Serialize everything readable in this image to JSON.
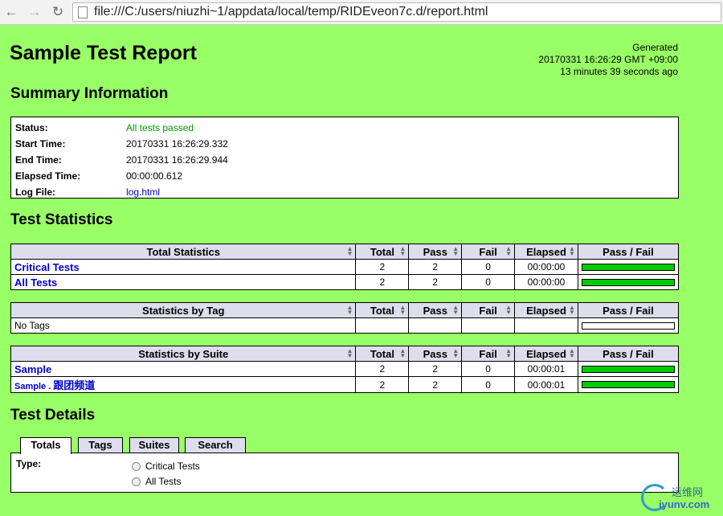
{
  "browser": {
    "url": "file:///C:/users/niuzhi~1/appdata/local/temp/RIDEveon7c.d/report.html"
  },
  "report": {
    "title": "Sample Test Report",
    "generated_label": "Generated",
    "generated_time": "20170331 16:26:29 GMT +09:00",
    "generated_ago": "13 minutes 39 seconds ago"
  },
  "summary": {
    "heading": "Summary Information",
    "rows": [
      {
        "label": "Status:",
        "value": "All tests passed"
      },
      {
        "label": "Start Time:",
        "value": "20170331 16:26:29.332"
      },
      {
        "label": "End Time:",
        "value": "20170331 16:26:29.944"
      },
      {
        "label": "Elapsed Time:",
        "value": "00:00:00.612"
      },
      {
        "label": "Log File:",
        "value": "log.html"
      }
    ]
  },
  "statistics": {
    "heading": "Test Statistics",
    "columns": {
      "total": "Total",
      "pass": "Pass",
      "fail": "Fail",
      "elapsed": "Elapsed",
      "passfail": "Pass / Fail"
    },
    "total": {
      "header": "Total Statistics",
      "rows": [
        {
          "name": "Critical Tests",
          "total": "2",
          "pass": "2",
          "fail": "0",
          "elapsed": "00:00:00",
          "pass_fraction": 1.0
        },
        {
          "name": "All Tests",
          "total": "2",
          "pass": "2",
          "fail": "0",
          "elapsed": "00:00:00",
          "pass_fraction": 1.0
        }
      ]
    },
    "tag": {
      "header": "Statistics by Tag",
      "rows": [
        {
          "name": "No Tags",
          "total": "",
          "pass": "",
          "fail": "",
          "elapsed": "",
          "pass_fraction": 0
        }
      ]
    },
    "suite": {
      "header": "Statistics by Suite",
      "rows": [
        {
          "name": "Sample",
          "total": "2",
          "pass": "2",
          "fail": "0",
          "elapsed": "00:00:01",
          "pass_fraction": 1.0
        },
        {
          "name_parent": "Sample . ",
          "name": "跟团频道",
          "total": "2",
          "pass": "2",
          "fail": "0",
          "elapsed": "00:00:01",
          "pass_fraction": 1.0
        }
      ]
    }
  },
  "details": {
    "heading": "Test Details",
    "tabs": [
      "Totals",
      "Tags",
      "Suites",
      "Search"
    ],
    "type_label": "Type:",
    "options": [
      "Critical Tests",
      "All Tests"
    ]
  },
  "watermark": {
    "cn": "运维网",
    "en": "iyunv.com"
  },
  "colors": {
    "background": "#99ff66",
    "pass": "#00cc00",
    "header": "#ddddee",
    "link": "#0000cc"
  }
}
